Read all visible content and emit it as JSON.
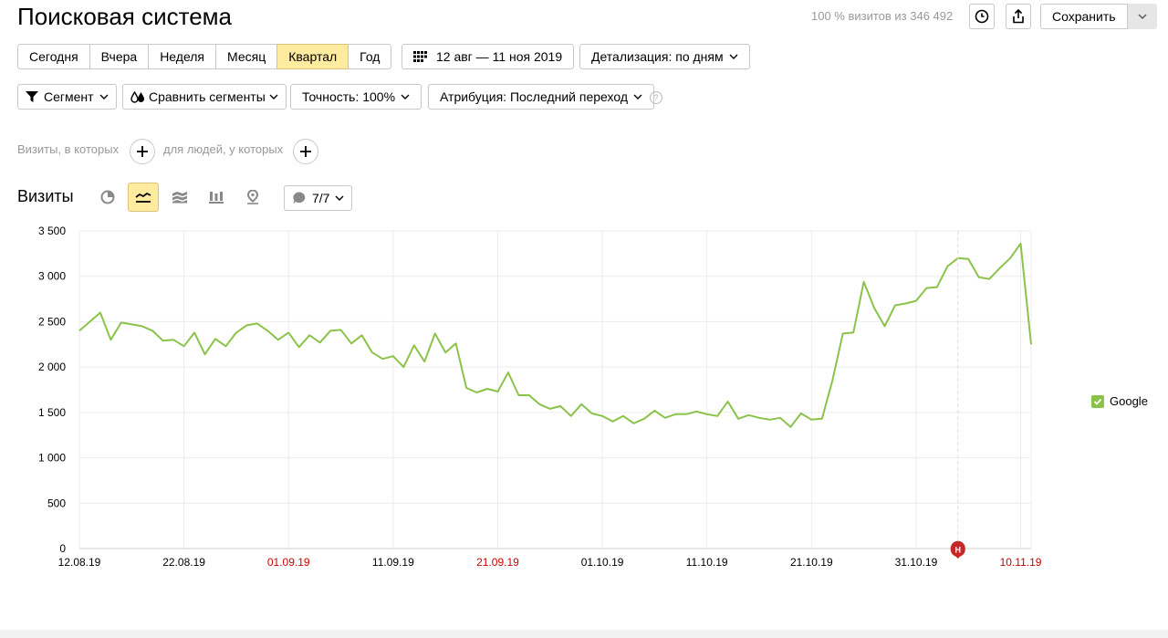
{
  "header": {
    "title": "Поисковая система",
    "visits_info": "100 % визитов из 346 492",
    "save_label": "Сохранить"
  },
  "period_buttons": [
    {
      "label": "Сегодня",
      "active": false
    },
    {
      "label": "Вчера",
      "active": false
    },
    {
      "label": "Неделя",
      "active": false
    },
    {
      "label": "Месяц",
      "active": false
    },
    {
      "label": "Квартал",
      "active": true
    },
    {
      "label": "Год",
      "active": false
    }
  ],
  "date_range": "12 авг — 11 ноя 2019",
  "detail": "Детализация: по дням",
  "segment": "Сегмент",
  "compare": "Сравнить сегменты",
  "accuracy": "Точность: 100%",
  "attribution": "Атрибуция: Последний переход",
  "filters": {
    "visits_label": "Визиты, в которых",
    "people_label": "для людей, у которых"
  },
  "chart_header": {
    "title": "Визиты",
    "notes_counter": "7/7"
  },
  "colors": {
    "series": "#8bc34a",
    "active": "#ffeba0",
    "holiday": "#cc0000"
  },
  "chart_data": {
    "type": "line",
    "ylim": [
      0,
      3500
    ],
    "y_ticks": [
      "0",
      "500",
      "1 000",
      "1 500",
      "2 000",
      "2 500",
      "3 000",
      "3 500"
    ],
    "x_ticks": [
      {
        "label": "12.08.19",
        "index": 0,
        "holiday": false
      },
      {
        "label": "22.08.19",
        "index": 10,
        "holiday": false
      },
      {
        "label": "01.09.19",
        "index": 20,
        "holiday": true
      },
      {
        "label": "11.09.19",
        "index": 30,
        "holiday": false
      },
      {
        "label": "21.09.19",
        "index": 40,
        "holiday": true
      },
      {
        "label": "01.10.19",
        "index": 50,
        "holiday": false
      },
      {
        "label": "11.10.19",
        "index": 60,
        "holiday": false
      },
      {
        "label": "21.10.19",
        "index": 70,
        "holiday": false
      },
      {
        "label": "31.10.19",
        "index": 80,
        "holiday": false
      },
      {
        "label": "10.11.19",
        "index": 90,
        "holiday": true
      }
    ],
    "note_marker": {
      "label": "Н",
      "index": 84
    },
    "series": [
      {
        "name": "Google",
        "values": [
          2400,
          2500,
          2600,
          2300,
          2490,
          2470,
          2450,
          2400,
          2290,
          2300,
          2230,
          2380,
          2140,
          2310,
          2230,
          2380,
          2460,
          2480,
          2400,
          2300,
          2380,
          2220,
          2350,
          2270,
          2400,
          2410,
          2260,
          2350,
          2160,
          2090,
          2120,
          2000,
          2240,
          2060,
          2370,
          2160,
          2260,
          1770,
          1720,
          1760,
          1730,
          1940,
          1690,
          1690,
          1590,
          1540,
          1570,
          1460,
          1590,
          1490,
          1460,
          1400,
          1460,
          1380,
          1430,
          1520,
          1440,
          1480,
          1480,
          1510,
          1480,
          1460,
          1620,
          1430,
          1470,
          1440,
          1420,
          1440,
          1340,
          1490,
          1420,
          1430,
          1850,
          2370,
          2380,
          2940,
          2650,
          2450,
          2680,
          2700,
          2730,
          2870,
          2880,
          3110,
          3200,
          3190,
          2990,
          2970,
          3090,
          3200,
          3360,
          2250
        ]
      }
    ]
  }
}
